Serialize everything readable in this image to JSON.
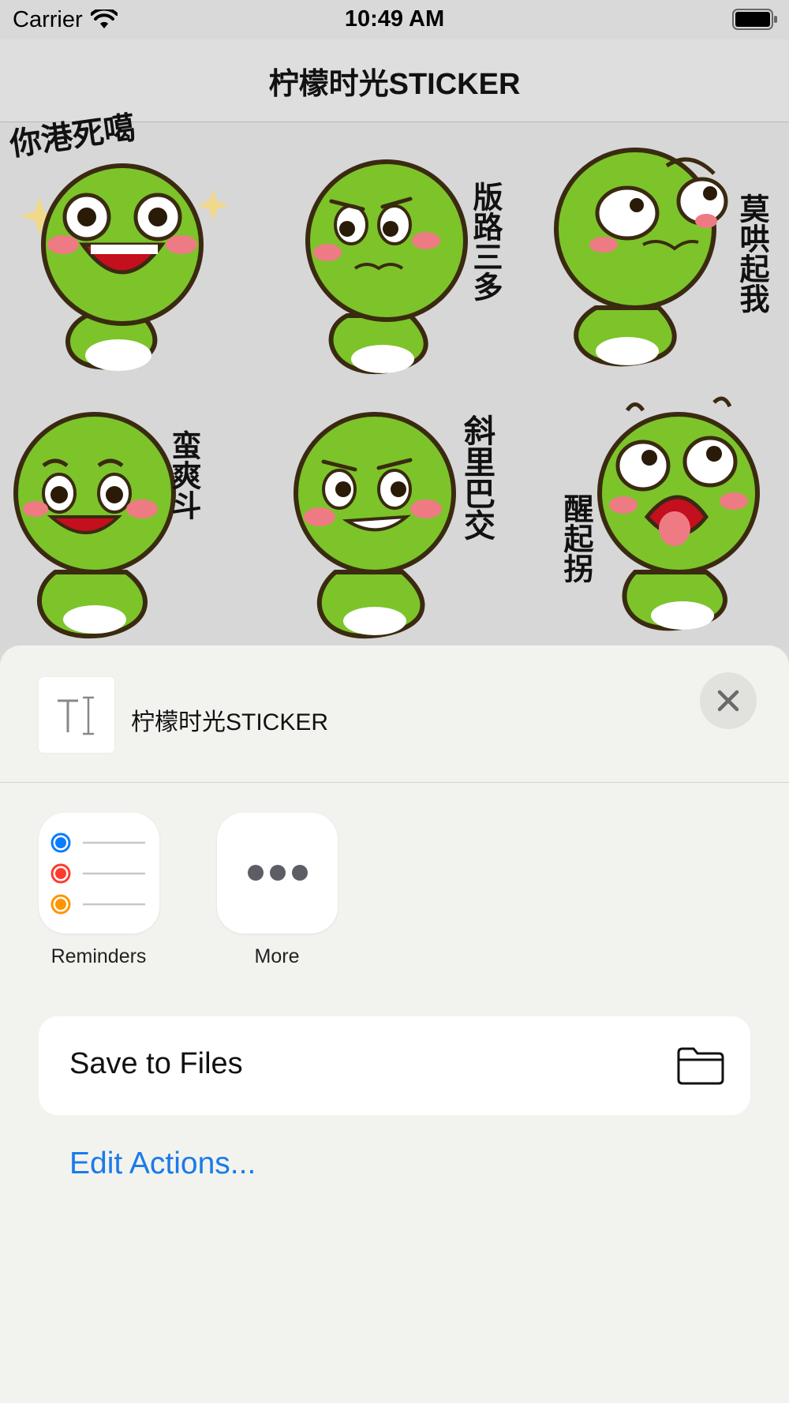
{
  "status_bar": {
    "carrier": "Carrier",
    "time": "10:49 AM"
  },
  "nav": {
    "title": "柠檬时光STICKER"
  },
  "stickers": [
    {
      "id": "s1",
      "text": "你港死噶"
    },
    {
      "id": "s2",
      "text": "版路三多"
    },
    {
      "id": "s3",
      "text": "莫哄起我"
    },
    {
      "id": "s4",
      "text": "蛮爽斗"
    },
    {
      "id": "s5",
      "text": "斜里巴交"
    },
    {
      "id": "s6",
      "text": "醒起拐"
    }
  ],
  "share_sheet": {
    "title": "柠檬时光STICKER",
    "apps": [
      {
        "label": "Reminders",
        "icon": "reminders-icon"
      },
      {
        "label": "More",
        "icon": "more-icon"
      }
    ],
    "action": {
      "label": "Save to Files",
      "icon": "folder-icon"
    },
    "edit_actions": "Edit Actions..."
  },
  "colors": {
    "sticker_green": "#7cc42a",
    "accent_blue": "#1a7aea",
    "reminder_blue": "#0a7cff",
    "reminder_red": "#ff3b30",
    "reminder_orange": "#ff9500"
  }
}
